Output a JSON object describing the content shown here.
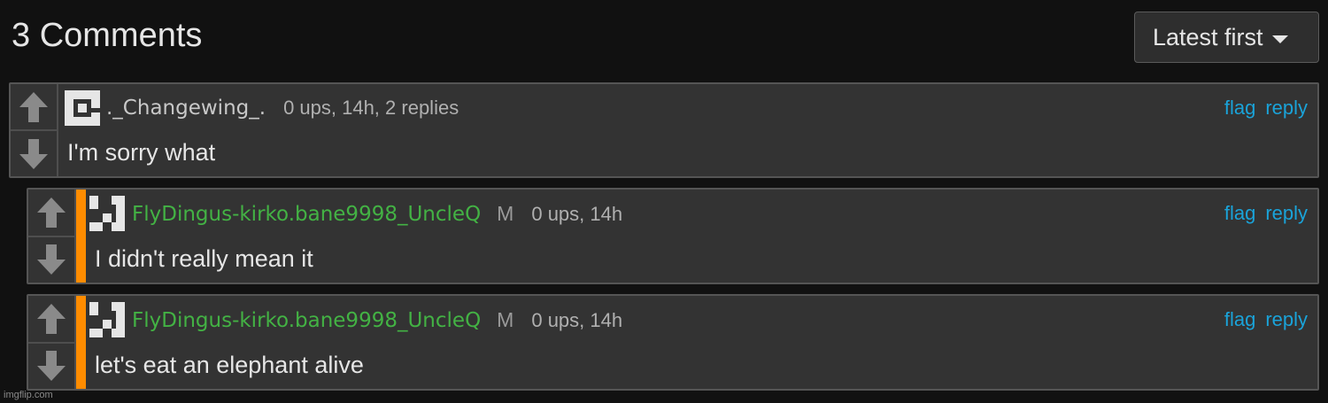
{
  "header": {
    "title": "3 Comments",
    "sort_label": "Latest first"
  },
  "comments": [
    {
      "username": "._Changewing_.",
      "username_color": "#c8c8c8",
      "stats": "0 ups, 14h, 2 replies",
      "flag": "flag",
      "reply": "reply",
      "text": "I'm sorry what"
    },
    {
      "username": "FlyDingus-kirko.bane9998_UncleQ",
      "username_color": "#43b244",
      "badge": "M",
      "stats": "0 ups, 14h",
      "flag": "flag",
      "reply": "reply",
      "text": "I didn't really mean it"
    },
    {
      "username": "FlyDingus-kirko.bane9998_UncleQ",
      "username_color": "#43b244",
      "badge": "M",
      "stats": "0 ups, 14h",
      "flag": "flag",
      "reply": "reply",
      "text": "let's eat an elephant alive"
    }
  ],
  "icons": {
    "upvote": "arrow-up-icon",
    "downvote": "arrow-down-icon",
    "sort_caret": "caret-down-icon"
  },
  "colors": {
    "background": "#111111",
    "card": "#333333",
    "link": "#1aa3d9",
    "reply_accent": "#ff8c00",
    "mod_username": "#43b244"
  },
  "watermark": "imgflip.com"
}
